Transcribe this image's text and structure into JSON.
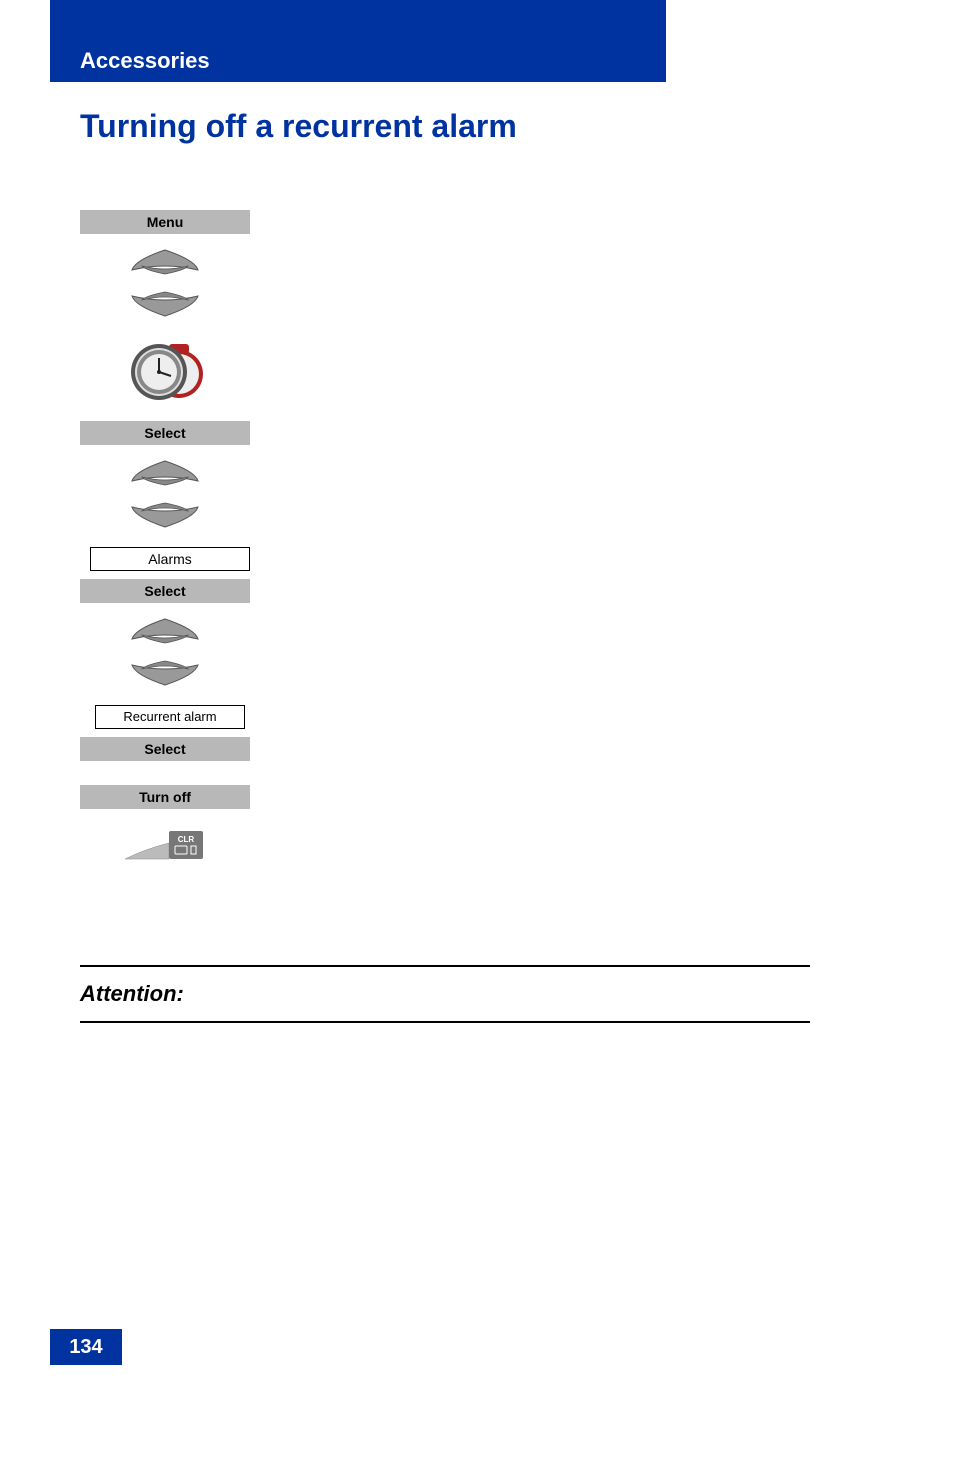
{
  "banner": {
    "section_label": "Accessories"
  },
  "title": "Turning off a recurrent alarm",
  "steps": {
    "menu_label": "Menu",
    "select_label_1": "Select",
    "alarms_box": "Alarms",
    "select_label_2": "Select",
    "recurrent_box": "Recurrent alarm",
    "select_label_3": "Select",
    "turnoff_label": "Turn off",
    "clr_label": "CLR"
  },
  "attention": {
    "label": "Attention:"
  },
  "page_number": "134"
}
